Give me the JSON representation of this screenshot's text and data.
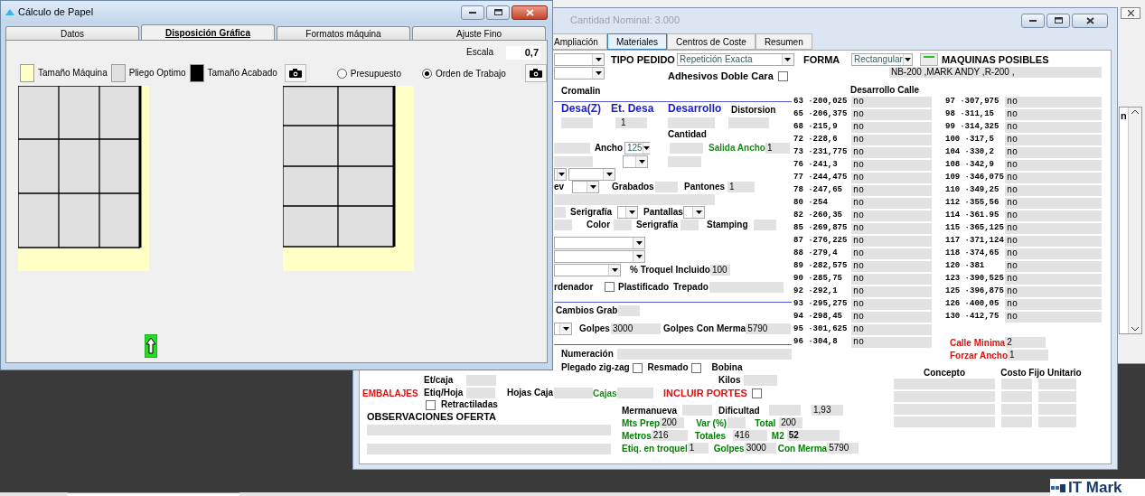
{
  "dialog": {
    "title": "Cálculo de Papel",
    "tabs": [
      {
        "label": "Datos",
        "selected": false
      },
      {
        "label": "Disposición Gráfica",
        "selected": true
      },
      {
        "label": "Formatos máquina",
        "selected": false
      },
      {
        "label": "Ajuste Fino",
        "selected": false
      }
    ],
    "scale": {
      "label": "Escala",
      "value": "0,7"
    },
    "legend": [
      {
        "label": "Tamaño Máquina",
        "color": "#ffffc6"
      },
      {
        "label": "Pliego Optimo",
        "color": "#e0e0e0"
      },
      {
        "label": "Tamaño Acabado",
        "color": "#000000"
      }
    ],
    "radios": [
      {
        "label": "Presupuesto",
        "selected": false
      },
      {
        "label": "Orden de Trabajo",
        "selected": true
      }
    ]
  },
  "window": {
    "title": "Cantidad Nominal: 3.000",
    "tabs": [
      {
        "label": "Ampliación",
        "selected": false
      },
      {
        "label": "Materiales",
        "selected": true
      },
      {
        "label": "Centros de Coste",
        "selected": false
      },
      {
        "label": "Resumen",
        "selected": false
      }
    ]
  },
  "header": {
    "tipo_pedido": {
      "label": "TIPO PEDIDO",
      "value": "Repetición Exacta"
    },
    "forma": {
      "label": "FORMA",
      "value": "Rectangular"
    },
    "maquinas": {
      "label": "MAQUINAS POSIBLES",
      "value": "NB-200 ,MARK ANDY ,R-200 ,"
    },
    "adhesivos": {
      "label": "Adhesivos Doble Cara",
      "checked": false
    }
  },
  "materials": {
    "cromalin": "Cromalin",
    "desa_z": "Desa(Z)",
    "et_desa": {
      "label": "Et. Desa",
      "value": "1"
    },
    "desarrollo": "Desarrollo",
    "distorsion": "Distorsion",
    "cantidad": "Cantidad",
    "ancho": {
      "label": "Ancho",
      "value": "125"
    },
    "salida_ancho": {
      "label": "Salida Ancho",
      "value": "1"
    },
    "relieve": "ev",
    "grabados": "Grabados",
    "pantones": {
      "label": "Pantones",
      "value": "1"
    },
    "serigrafia": "Serigrafía",
    "pantallas": "Pantallas",
    "color_label": "Color",
    "serigrafia_2": "Serigrafía",
    "stamping": "Stamping",
    "troquel": {
      "label": "% Troquel Incluido",
      "value": "100"
    },
    "ordenador": {
      "label": "rdenador",
      "checked": false
    },
    "plastificado": "Plastificado",
    "trepado": "Trepado",
    "cambios_grab": "Cambios Grab",
    "golpes": {
      "label": "Golpes",
      "value": "3000"
    },
    "golpes_merma": {
      "label": "Golpes Con Merma",
      "value": "5790"
    },
    "numeracion": "Numeración"
  },
  "calle": {
    "title": "Desarrollo Calle",
    "left": [
      {
        "number": "63 ·200,025",
        "value": "no"
      },
      {
        "number": "65 ·206,375",
        "value": "no"
      },
      {
        "number": "68 ·215,9",
        "value": "no"
      },
      {
        "number": "72 ·228,6",
        "value": "no"
      },
      {
        "number": "73 ·231,775",
        "value": "no"
      },
      {
        "number": "76 ·241,3",
        "value": "no"
      },
      {
        "number": "77 ·244,475",
        "value": "no"
      },
      {
        "number": "78 ·247,65",
        "value": "no"
      },
      {
        "number": "80 ·254",
        "value": "no"
      },
      {
        "number": "82 ·260,35",
        "value": "no"
      },
      {
        "number": "85 ·269,875",
        "value": "no"
      },
      {
        "number": "87 ·276,225",
        "value": "no"
      },
      {
        "number": "88 ·279,4",
        "value": "no"
      },
      {
        "number": "89 ·282,575",
        "value": "no"
      },
      {
        "number": "90 ·285,75",
        "value": "no"
      },
      {
        "number": "92 ·292,1",
        "value": "no"
      },
      {
        "number": "93 ·295,275",
        "value": "no"
      },
      {
        "number": "94 ·298,45",
        "value": "no"
      },
      {
        "number": "95 ·301,625",
        "value": "no"
      },
      {
        "number": "96 ·304,8",
        "value": "no"
      }
    ],
    "right": [
      {
        "number": "97 ·307,975",
        "value": "no"
      },
      {
        "number": "98 ·311,15",
        "value": "no"
      },
      {
        "number": "99 ·314,325",
        "value": "no"
      },
      {
        "number": "100 ·317,5",
        "value": "no"
      },
      {
        "number": "104 ·330,2",
        "value": "no"
      },
      {
        "number": "108 ·342,9",
        "value": "no"
      },
      {
        "number": "109 ·346,075",
        "value": "no"
      },
      {
        "number": "110 ·349,25",
        "value": "no"
      },
      {
        "number": "112 ·355,56",
        "value": "no"
      },
      {
        "number": "114 ·361.95",
        "value": "no"
      },
      {
        "number": "115 ·365,125",
        "value": "no"
      },
      {
        "number": "117 ·371,124",
        "value": "no"
      },
      {
        "number": "118 ·374,65",
        "value": "no"
      },
      {
        "number": "120 ·381",
        "value": "no"
      },
      {
        "number": "123 ·390,525",
        "value": "no"
      },
      {
        "number": "125 ·396,875",
        "value": "no"
      },
      {
        "number": "126 ·400,05",
        "value": "no"
      },
      {
        "number": "130 ·412,75",
        "value": "no"
      }
    ],
    "calle_minima": {
      "label": "Calle Minima",
      "value": "2"
    },
    "forzar_ancho": {
      "label": "Forzar Ancho",
      "value": "1"
    }
  },
  "finishing": [
    {
      "label": "Plegado zig-zag",
      "checked": false
    },
    {
      "label": "Resmado",
      "checked": false
    }
  ],
  "bobina": "Bobina",
  "packaging": {
    "title": "EMBALAJES",
    "et_caja": "Et/caja",
    "etiq_hoja": "Etiq/Hoja",
    "hojas_caja": "Hojas Caja",
    "cajas": "Cajas",
    "kilos": "Kilos",
    "incluir_portes": {
      "label": "INCLUIR PORTES",
      "checked": false
    },
    "retractiladas": {
      "label": "Retractiladas",
      "checked": false
    }
  },
  "observaciones": "OBSERVACIONES OFERTA",
  "production": [
    [
      {
        "label": "Mermanueva",
        "color": "#000000"
      },
      {
        "label": "Dificultad",
        "color": "#000000"
      },
      {
        "value": "1,93"
      }
    ],
    [
      {
        "label": "Mts Prep",
        "value": "200",
        "color": "#008000"
      },
      {
        "label": "Var (%)",
        "color": "#008000"
      },
      {
        "label": "Total",
        "value": "200",
        "color": "#008000"
      }
    ],
    [
      {
        "label": "Metros",
        "value": "216",
        "color": "#008000"
      },
      {
        "label": "Totales",
        "value": "416",
        "color": "#008000"
      },
      {
        "label": "M2",
        "value": "52",
        "color": "#008000",
        "emphasis": true
      }
    ],
    [
      {
        "label": "Etiq. en troquel",
        "value": "1",
        "color": "#008000"
      },
      {
        "label": "Golpes",
        "value": "3000",
        "color": "#008000"
      },
      {
        "label": "Con Merma",
        "value": "5790",
        "color": "#008000"
      }
    ]
  ],
  "costs": {
    "columns": [
      "Concepto",
      "Costo Fijo Unitario"
    ]
  },
  "background": {
    "cut_text": "n",
    "logo": "IT Mark"
  }
}
